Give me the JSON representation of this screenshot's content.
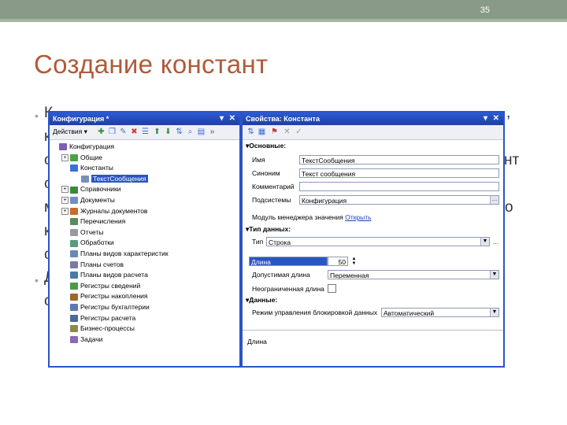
{
  "slide": {
    "number": "35",
    "title": "Создание констант"
  },
  "bg_text": {
    "l1_start": "К",
    "l1_end": ", ",
    "l2": "к",
    "l3": "с",
    "l3_end": "нт",
    "l4": "с",
    "l5": "м",
    "l5_end": "о",
    "l6": "к",
    "l7": "с",
    "l8": "Д",
    "l9": "с"
  },
  "config_window": {
    "title": "Конфигурация *",
    "actions_label": "Действия ▾",
    "tree": [
      {
        "label": "Конфигурация",
        "icon": "config-icon",
        "color": "#7c5fb4"
      },
      {
        "label": "Общие",
        "icon": "common-icon",
        "color": "#4aa14a"
      },
      {
        "label": "Константы",
        "icon": "constants-icon",
        "color": "#3b6fd8"
      },
      {
        "label": "ТекстСообщения",
        "icon": "constant-item-icon",
        "color": "#7a8fb8"
      },
      {
        "label": "Справочники",
        "icon": "catalogs-icon",
        "color": "#3a8a3a"
      },
      {
        "label": "Документы",
        "icon": "documents-icon",
        "color": "#6f8fc4"
      },
      {
        "label": "Журналы документов",
        "icon": "journals-icon",
        "color": "#c86a2a"
      },
      {
        "label": "Перечисления",
        "icon": "enums-icon",
        "color": "#5a8a5a"
      },
      {
        "label": "Отчеты",
        "icon": "reports-icon",
        "color": "#9a9a9a"
      },
      {
        "label": "Обработки",
        "icon": "processing-icon",
        "color": "#5a9a7a"
      },
      {
        "label": "Планы видов характеристик",
        "icon": "char-plans-icon",
        "color": "#6a8ab4"
      },
      {
        "label": "Планы счетов",
        "icon": "account-plans-icon",
        "color": "#7a7aa4"
      },
      {
        "label": "Планы видов расчета",
        "icon": "calc-plans-icon",
        "color": "#4a7aa4"
      },
      {
        "label": "Регистры сведений",
        "icon": "info-registers-icon",
        "color": "#4a9a4a"
      },
      {
        "label": "Регистры накопления",
        "icon": "accum-registers-icon",
        "color": "#9a6a2a"
      },
      {
        "label": "Регистры бухгалтерии",
        "icon": "accounting-registers-icon",
        "color": "#5a7ab4"
      },
      {
        "label": "Регистры расчета",
        "icon": "calc-registers-icon",
        "color": "#4a6a9a"
      },
      {
        "label": "Бизнес-процессы",
        "icon": "business-processes-icon",
        "color": "#8a8a4a"
      },
      {
        "label": "Задачи",
        "icon": "tasks-icon",
        "color": "#8a6ab4"
      }
    ]
  },
  "props_window": {
    "title": "Свойства: Константа",
    "section_main": "Основные:",
    "name_label": "Имя",
    "name_value": "ТекстСообщения",
    "synonym_label": "Синоним",
    "synonym_value": "Текст сообщения",
    "comment_label": "Комментарий",
    "comment_value": "",
    "subsystems_label": "Подсистемы",
    "subsystems_value": "Конфигурация",
    "manager_label": "Модуль менеджера значения",
    "manager_link": "Открыть",
    "section_type": "Тип данных:",
    "type_label": "Тип",
    "type_value": "Строка",
    "length_label": "Длина",
    "length_value": "50",
    "allowed_length_label": "Допустимая длина",
    "allowed_length_value": "Переменная",
    "unlimited_label": "Неограниченная длина",
    "section_data": "Данные:",
    "lock_mode_label": "Режим управления блокировкой данных",
    "lock_mode_value": "Автоматический",
    "description": "Длина"
  }
}
